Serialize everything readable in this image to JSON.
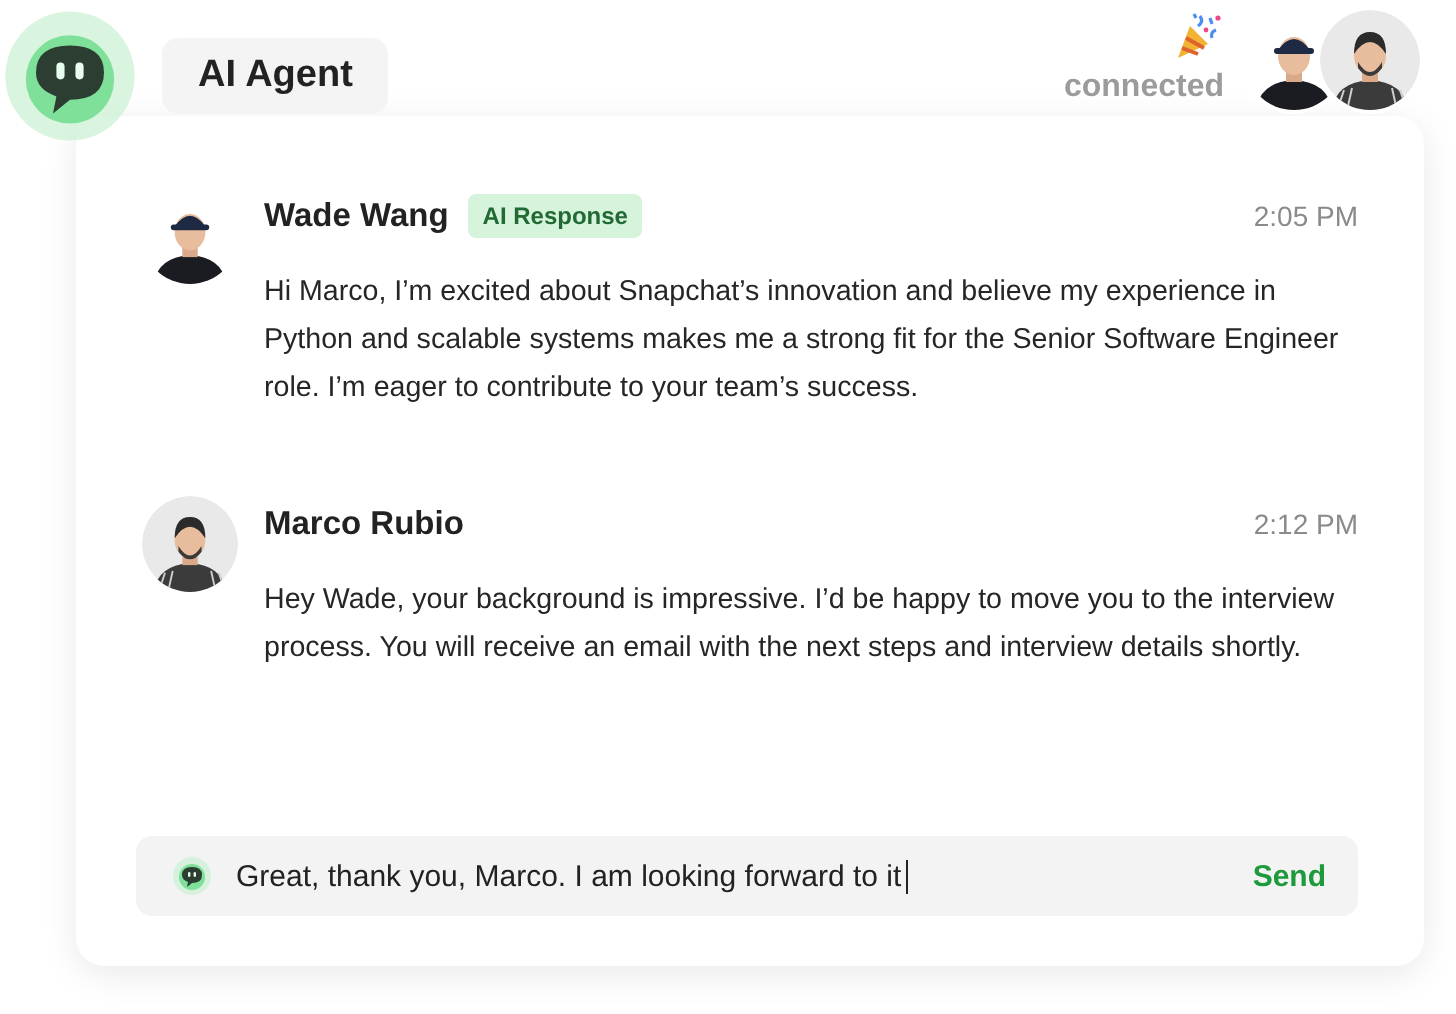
{
  "header": {
    "title": "AI Agent",
    "status": "connected"
  },
  "messages": [
    {
      "sender": "Wade Wang",
      "badge": "AI Response",
      "time": "2:05 PM",
      "text": "Hi Marco, I’m excited about Snapchat’s innovation and believe my experience in Python and scalable systems makes me a strong fit for the Senior Software Engineer role. I’m eager to contribute to your team’s success."
    },
    {
      "sender": "Marco Rubio",
      "time": "2:12 PM",
      "text": "Hey Wade, your background is impressive. I’d be happy to move you to the interview process. You will receive an email with the next steps and interview details shortly."
    }
  ],
  "composer": {
    "value": "Great, thank you, Marco. I am looking forward to it",
    "action": "Send"
  }
}
